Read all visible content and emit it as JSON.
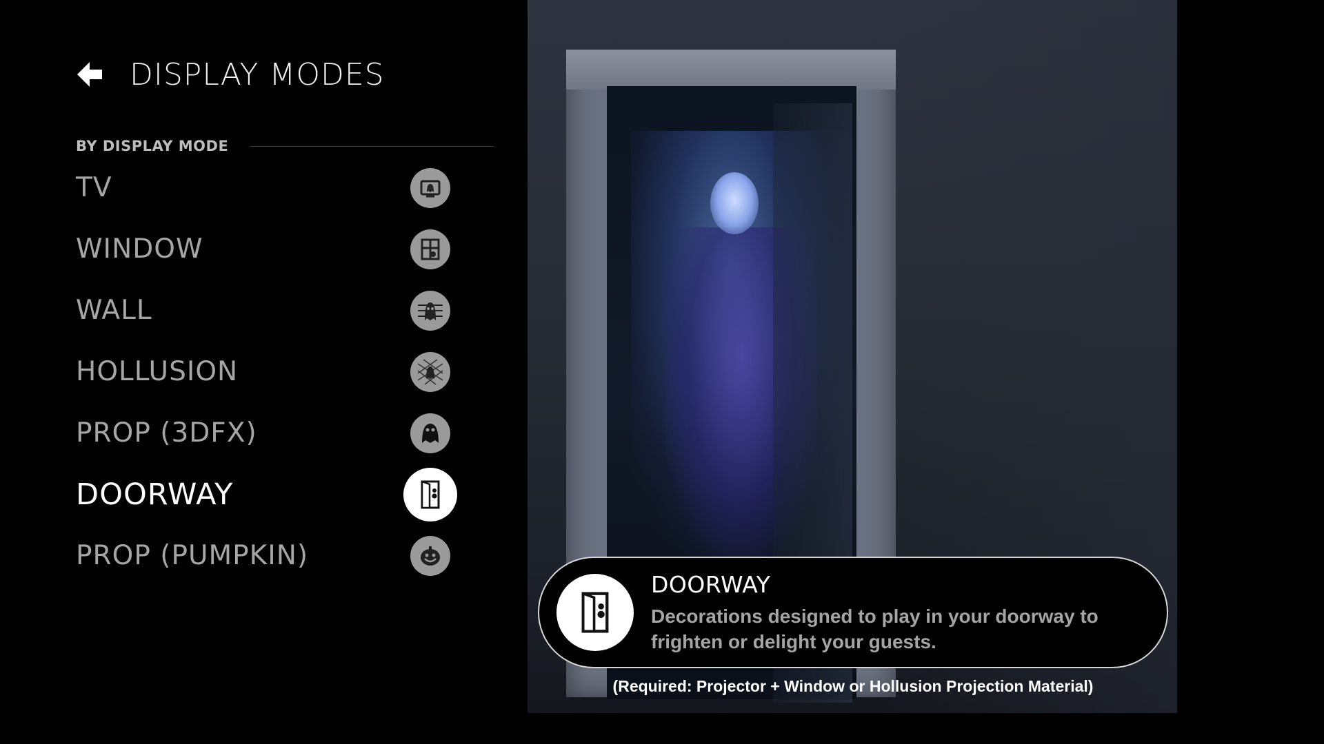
{
  "header": {
    "back_icon": "back-arrow-icon",
    "title": "DISPLAY MODES"
  },
  "section": {
    "label": "BY DISPLAY MODE"
  },
  "modes": [
    {
      "label": "TV",
      "icon": "tv-ghost-icon",
      "selected": false
    },
    {
      "label": "WINDOW",
      "icon": "window-ghost-icon",
      "selected": false
    },
    {
      "label": "WALL",
      "icon": "wall-ghost-icon",
      "selected": false
    },
    {
      "label": "HOLLUSION",
      "icon": "hollusion-mesh-icon",
      "selected": false
    },
    {
      "label": "PROP (3DFX)",
      "icon": "ghost-prop-icon",
      "selected": false
    },
    {
      "label": "DOORWAY",
      "icon": "doorway-icon",
      "selected": true
    },
    {
      "label": "PROP (PUMPKIN)",
      "icon": "pumpkin-icon",
      "selected": false
    }
  ],
  "info": {
    "title": "DOORWAY",
    "description": "Decorations designed to play in your doorway to frighten or delight your guests.",
    "icon": "doorway-icon"
  },
  "requirement": "(Required: Projector + Window or Hollusion Projection Material)",
  "colors": {
    "background": "#000000",
    "unselected_text": "#a6a6a6",
    "selected_text": "#ffffff",
    "icon_circle": "#9a9a9a",
    "ghost_glow": "#78aaff"
  }
}
